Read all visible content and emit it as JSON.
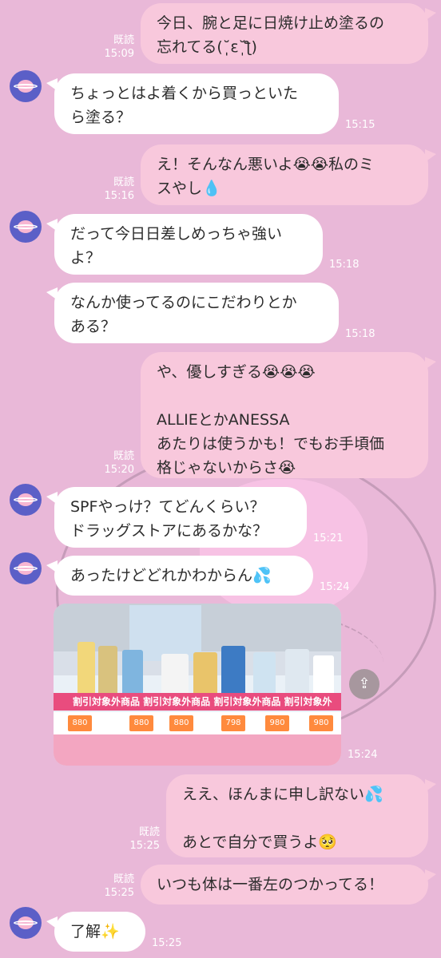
{
  "messages": {
    "m1": {
      "text": "今日、腕と足に日焼け止め塗るの\n忘れてる(˘̩̩̩ε˘̩ƪ)",
      "read": "既読",
      "time": "15:09"
    },
    "m2": {
      "text": "ちょっとはよ着くから買っといた\nら塗る？",
      "time": "15:15"
    },
    "m3": {
      "text": "え！そんなん悪いよ😭😭私のミ\nスやし💧",
      "read": "既読",
      "time": "15:16"
    },
    "m4": {
      "text": "だって今日日差しめっちゃ強い\nよ？",
      "time": "15:18"
    },
    "m5": {
      "text": "なんか使ってるのにこだわりとか\nある？",
      "time": "15:18"
    },
    "m6": {
      "text": "や、優しすぎる😭😭😭\n\nALLIEとかANESSA\nあたりは使うかも！でもお手頃価\n格じゃないからさ😭",
      "read": "既読",
      "time": "15:20"
    },
    "m7": {
      "text": "SPFやっけ？てどんくらい？\nドラッグストアにあるかな？",
      "time": "15:21"
    },
    "m8": {
      "text": "あったけどどれかわからん💦",
      "time": "15:24"
    },
    "m9": {
      "time": "15:24",
      "photo_banner": "割引対象外商品 割引対象外商品 割引対象外商品 割引対象外",
      "prices": [
        "880",
        "880",
        "880",
        "798",
        "980",
        "980"
      ],
      "share_icon": "share-icon"
    },
    "m10": {
      "text": "ええ、ほんまに申し訳ない💦\n\nあとで自分で買うよ🥺",
      "read": "既読",
      "time": "15:25"
    },
    "m11": {
      "text": "いつも体は一番左のつかってる！",
      "read": "既読",
      "time": "15:25"
    },
    "m12": {
      "text": "了解✨",
      "time": "15:25"
    }
  },
  "colors": {
    "background": "#e9b8d8",
    "incoming": "#ffffff",
    "outgoing": "#f8c8dc",
    "avatar": "#5b5fc7"
  }
}
